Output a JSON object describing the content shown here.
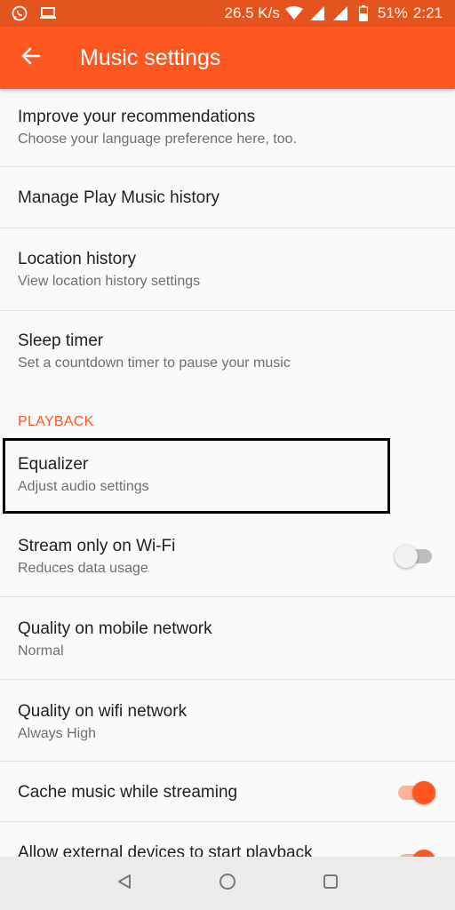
{
  "status_bar": {
    "speed": "26.5 K/s",
    "battery": "51%",
    "time": "2:21",
    "icons": [
      "whatsapp-icon",
      "laptop-icon",
      "wifi-icon",
      "signal-icon",
      "signal-icon",
      "battery-icon"
    ]
  },
  "app_bar": {
    "title": "Music settings",
    "back_icon": "arrow-back-icon"
  },
  "settings": {
    "recommendations": {
      "title": "Improve your recommendations",
      "subtitle": "Choose your language preference here, too."
    },
    "history": {
      "title": "Manage Play Music history"
    },
    "location": {
      "title": "Location history",
      "subtitle": "View location history settings"
    },
    "sleep": {
      "title": "Sleep timer",
      "subtitle": "Set a countdown timer to pause your music"
    },
    "playback_header": "PLAYBACK",
    "equalizer": {
      "title": "Equalizer",
      "subtitle": "Adjust audio settings"
    },
    "wifi_only": {
      "title": "Stream only on Wi-Fi",
      "subtitle": "Reduces data usage",
      "enabled": false
    },
    "mobile_quality": {
      "title": "Quality on mobile network",
      "subtitle": "Normal"
    },
    "wifi_quality": {
      "title": "Quality on wifi network",
      "subtitle": "Always High"
    },
    "cache": {
      "title": "Cache music while streaming",
      "enabled": true
    },
    "external": {
      "title": "Allow external devices to start playback",
      "enabled": true
    }
  },
  "nav_bar": {
    "icons": [
      "back-triangle-icon",
      "home-circle-icon",
      "recents-square-icon"
    ]
  },
  "colors": {
    "accent": "#ff5722",
    "status_bar": "#e5531f"
  }
}
